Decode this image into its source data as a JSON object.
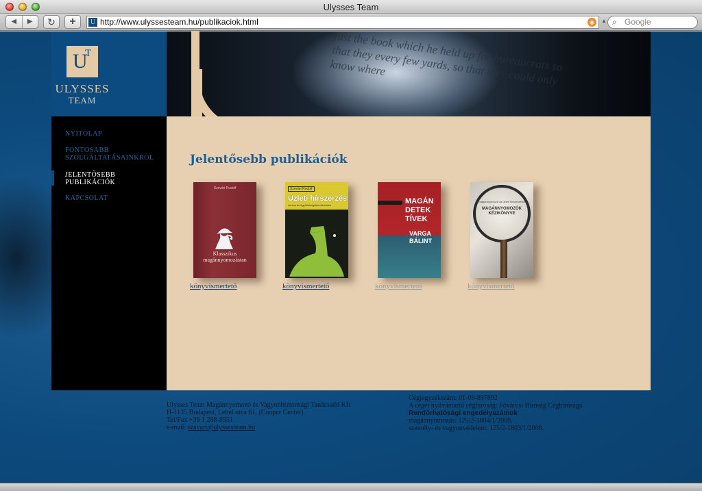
{
  "browser": {
    "window_title": "Ulysses Team",
    "url": "http://www.ulyssesteam.hu/publikaciok.html",
    "search_placeholder": "Google",
    "back_glyph": "◀",
    "forward_glyph": "▶",
    "reload_glyph": "↻",
    "add_glyph": "+",
    "favicon_text": "U",
    "search_glyph": "🔍"
  },
  "logo": {
    "mark_u": "U",
    "mark_t": "T",
    "line1": "ULYSSES",
    "line2": "TEAM"
  },
  "banner": {
    "text": "just the book which he held up for bureaucrats so that they every few yards, so that they could only know where"
  },
  "nav": [
    {
      "label": "NYITÓLAP",
      "active": false
    },
    {
      "label": "FONTOSABB SZOLGÁLTATÁSAINKRÓL",
      "active": false
    },
    {
      "label": "JELENTŐSEBB PUBLIKÁCIÓK",
      "active": true
    },
    {
      "label": "KAPCSOLAT",
      "active": false
    }
  ],
  "main": {
    "heading": "Jelentősebb publikációk",
    "books": [
      {
        "author": "Szevári Rudolf",
        "title": "Klasszikus magánnyomozástan",
        "link": "könyvismertető",
        "link_active": true
      },
      {
        "author": "Szevári Rudolf",
        "title": "Üzleti hírszerzés",
        "subtitle": "versus az ügyfélszolgálat ellenében",
        "link": "könyvismertető",
        "link_active": true
      },
      {
        "title": "MAGÁN DETEK TÍVEK",
        "author": "VARGA BÁLINT",
        "link": "könyvismertető",
        "link_active": false
      },
      {
        "small": "A magánnyomozó az üzleti hírszerzésben",
        "title": "MAGÁNNYOMOZÓK KÉZIKÖNYVE",
        "link": "könyvismertető",
        "link_active": false
      }
    ]
  },
  "footer": {
    "company": "Ulysses Team Magánnyomozó és Vagyonbiztonsági Tanácsadó Kft",
    "address": "H-1135 Budapest, Lehel utca 61. (Cooper Center)",
    "phone": "Tel/Fax +36 1 288-8551",
    "email_label": "e-mail:",
    "email": "szavari@ulyssesteam.hu",
    "reg_no": "Cégjegyzékszám: 01-09-897892",
    "court": "A céget nyilvántartó cégbíróság: Fővárosi Bíróság Cégbírósága",
    "licenses_title": "Rendőrhatósági engedélyszámok",
    "license1": "magánnyomozás: 125/2-1804/1/2008.",
    "license2": "személy- és vagyonvédelem: 125/2-1803/1/2008."
  },
  "colors": {
    "brand_blue": "#0c4b7f",
    "brand_beige": "#e3c9a6",
    "content_bg": "#e7cfb2",
    "heading_blue": "#1d5f96"
  }
}
